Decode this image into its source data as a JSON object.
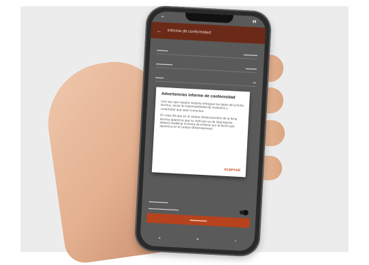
{
  "app": {
    "title": "Informe de conformidad"
  },
  "dialog": {
    "title": "Advertencias informe de conformidad",
    "paragraph1": "Una vez que nuestro sistema entregue los datos de la ficha técnica, recae la responsabilidad de revisarlos y comprobar que sean correctos.",
    "paragraph2": "En caso de que en el campo Observaciones de la ficha técnica aparezca que su vehículo es de importación, deberá modificar la fecha de emisión por la fecha que aparezca en el campo Observaciones.",
    "action_label": "ACEPTAR"
  },
  "colors": {
    "app_bar": "#6b2a18",
    "accent": "#b6431d",
    "dialog_action": "#c24a1f"
  },
  "icons": {
    "back": "back-arrow-icon",
    "nav": [
      "nav-back-icon",
      "nav-home-icon",
      "nav-recents-icon"
    ]
  }
}
